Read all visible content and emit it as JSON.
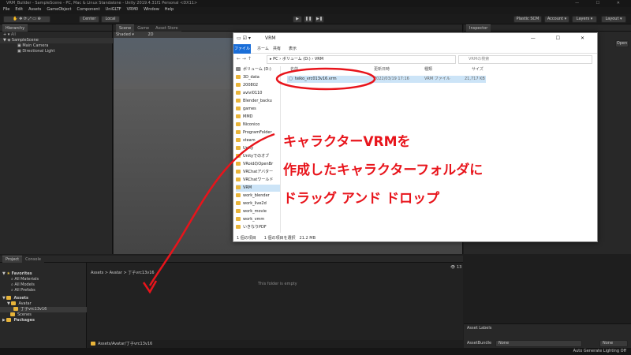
{
  "window": {
    "title": "VRM_Builder - SampleScene - PC, Mac & Linux Standalone - Unity 2019.4.31f1 Personal <DX11>"
  },
  "menu": [
    "File",
    "Edit",
    "Assets",
    "GameObject",
    "Component",
    "UniGLTF",
    "VRM0",
    "Window",
    "Help"
  ],
  "toolbar": {
    "center": "Center",
    "local": "Local",
    "plastic": "Plastic SCM",
    "account": "Account",
    "layers": "Layers",
    "layout": "Layout"
  },
  "hierarchy": {
    "tab": "Hierarchy",
    "search_placeholder": "All",
    "scene": "SampleScene",
    "items": [
      "Main Camera",
      "Directional Light"
    ]
  },
  "scene": {
    "tabs": [
      "Scene",
      "Game",
      "Asset Store"
    ],
    "shading": "Shaded",
    "mode": "2D"
  },
  "inspector": {
    "tab": "Inspector",
    "open": "Open"
  },
  "explorer": {
    "title": "VRM",
    "ribbon": [
      "ファイル",
      "ホーム",
      "共有",
      "表示"
    ],
    "address": [
      "PC",
      "ボリューム (D:)",
      "VRM"
    ],
    "search_placeholder": "VRMの検索",
    "columns": [
      "名前",
      "更新日時",
      "種類",
      "サイズ"
    ],
    "file": {
      "name": "teiko_vrc013v16.vrm",
      "date": "2022/03/19 17:16",
      "type": "VRM ファイル",
      "size": "21,717 KB"
    },
    "nav": [
      "ボリューム (D:)",
      "3D_data",
      "200802",
      "avivi0110",
      "Blender_backu",
      "games",
      "MMD",
      "Niconico",
      "ProgramFolder",
      "steam",
      "Unity",
      "Unityでのオブ",
      "VRoidのOpenBr",
      "VRChatアバター",
      "VRChatワールド",
      "VRM",
      "work_blender",
      "work_live2d",
      "work_movie",
      "work_vmm",
      "いきなりPDF"
    ],
    "status": "1 個の項目　　1 個の項目を選択　21.2 MB"
  },
  "annotation": {
    "line1": "キャラクターVRMを",
    "line2": "作成したキャラクターフォルダに",
    "line3": "ドラッグ アンド ドロップ"
  },
  "project": {
    "tabs": [
      "Project",
      "Console"
    ],
    "favorites": "Favorites",
    "fav_items": [
      "All Materials",
      "All Models",
      "All Prefabs"
    ],
    "assets": "Assets",
    "tree": [
      "Avatar",
      "丁子vrc13v16",
      "Scenes"
    ],
    "packages": "Packages",
    "breadcrumb": "Assets > Avatar > 丁子vrc13v16",
    "empty": "This folder is empty",
    "path": "Assets/Avatar/丁子vrc13v16",
    "count": "13"
  },
  "asset_labels": {
    "title": "Asset Labels",
    "bundle": "AssetBundle",
    "none1": "None",
    "none2": "None"
  },
  "status": "Auto Generate Lighting Off"
}
